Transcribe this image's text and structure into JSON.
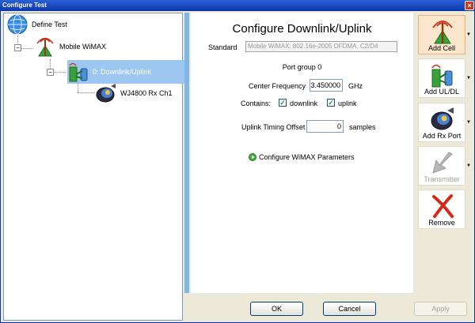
{
  "window": {
    "title": "Configure Test",
    "close_glyph": "×"
  },
  "tree": {
    "root": {
      "label": "Define Test",
      "icon": "globe-icon"
    },
    "cell": {
      "label": "Mobile WiMAX",
      "icon": "antenna-tower-icon",
      "expander": "−"
    },
    "downlink": {
      "label": "0: Downlink/Uplink",
      "icon": "downlink-uplink-icon",
      "expander": "−"
    },
    "rxport": {
      "label": "WJ4800 Rx Ch1",
      "icon": "rf-connector-icon"
    }
  },
  "form": {
    "title": "Configure Downlink/Uplink",
    "standard_label": "Standard",
    "standard_value": "Mobile WiMAX: 802.16e-2005 OFDMA, C2/D4",
    "port_group": "Port group 0",
    "center_freq_label": "Center Frequency",
    "center_freq_value": "3.450000",
    "center_freq_unit": "GHz",
    "contains_label": "Contains:",
    "downlink_label": "downlink",
    "downlink_checked": true,
    "uplink_label": "uplink",
    "uplink_checked": true,
    "check_glyph": "✓",
    "uto_label": "Uplink Timing Offset",
    "uto_value": "0",
    "uto_unit": "samples",
    "wimax_link": "Configure WiMAX Parameters"
  },
  "toolbar": {
    "add_cell": "Add Cell",
    "add_ul_dl": "Add UL/DL",
    "add_rx_port": "Add Rx Port",
    "transmitter": "Transmitter",
    "remove": "Remove",
    "dropdown_glyph": "▼"
  },
  "buttons": {
    "ok": "OK",
    "cancel": "Cancel",
    "apply": "Apply"
  },
  "colors": {
    "accent": "#0a37a8",
    "selection": "#9dc6f0",
    "splitter": "#7fb7e8",
    "check": "#21a121",
    "active_tool": "#fbe6cd"
  }
}
